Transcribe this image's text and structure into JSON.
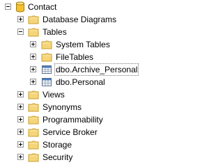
{
  "tree": {
    "root_label": "Contact",
    "database_diagrams": "Database Diagrams",
    "tables": "Tables",
    "system_tables": "System Tables",
    "file_tables": "FileTables",
    "table_archive_personal": "dbo.Archive_Personal",
    "table_personal": "dbo.Personal",
    "views": "Views",
    "synonyms": "Synonyms",
    "programmability": "Programmability",
    "service_broker": "Service Broker",
    "storage": "Storage",
    "security": "Security"
  },
  "colors": {
    "folder_fill": "#f5d57a",
    "folder_border": "#c99f2d",
    "database_fill": "#f2c230",
    "table_header": "#4a7cc0",
    "tree_lines": "#919191"
  },
  "icons": {
    "database": "database-icon",
    "folder": "folder-icon",
    "table": "table-icon"
  }
}
